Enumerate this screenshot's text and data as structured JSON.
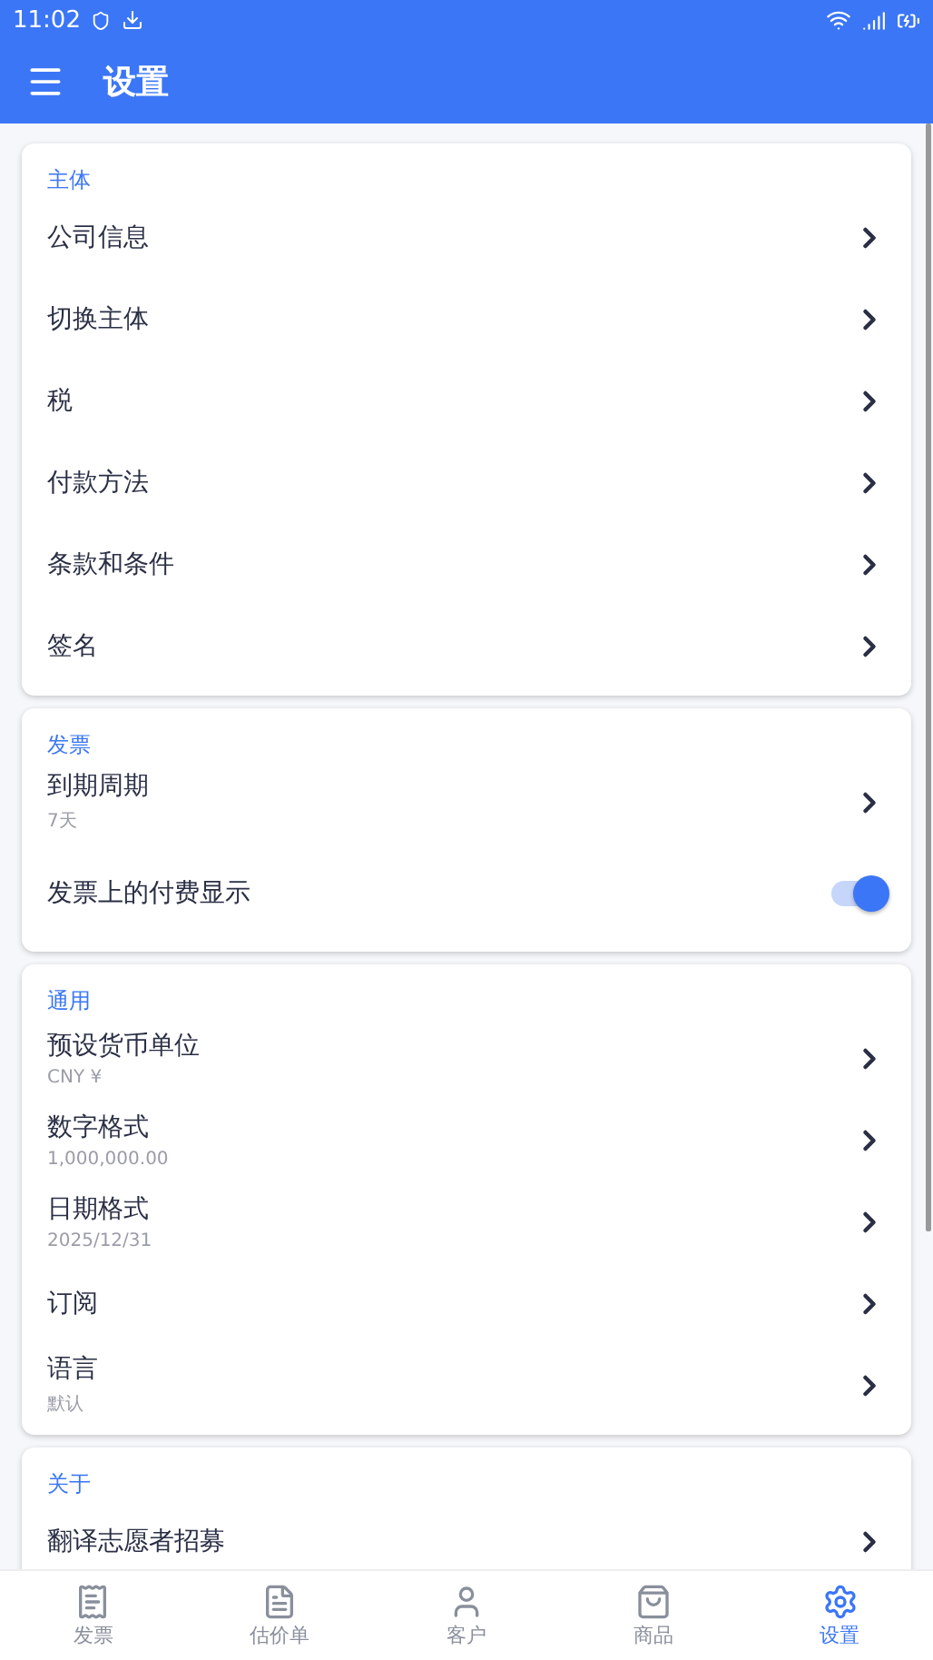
{
  "status_bar": {
    "time": "11:02"
  },
  "app_bar": {
    "title": "设置"
  },
  "sections": [
    {
      "title": "主体",
      "items": [
        {
          "kind": "link",
          "label": "公司信息"
        },
        {
          "kind": "link",
          "label": "切换主体"
        },
        {
          "kind": "link",
          "label": "税"
        },
        {
          "kind": "link",
          "label": "付款方法"
        },
        {
          "kind": "link",
          "label": "条款和条件"
        },
        {
          "kind": "link",
          "label": "签名"
        }
      ]
    },
    {
      "title": "发票",
      "items": [
        {
          "kind": "link",
          "label": "到期周期",
          "subtitle": "7天"
        },
        {
          "kind": "toggle",
          "label": "发票上的付费显示",
          "on": true
        }
      ]
    },
    {
      "title": "通用",
      "items": [
        {
          "kind": "link",
          "label": "预设货币单位",
          "subtitle": "CNY ¥"
        },
        {
          "kind": "link",
          "label": "数字格式",
          "subtitle": "1,000,000.00"
        },
        {
          "kind": "link",
          "label": "日期格式",
          "subtitle": "2025/12/31"
        },
        {
          "kind": "link",
          "label": "订阅"
        },
        {
          "kind": "link",
          "label": "语言",
          "subtitle": "默认"
        }
      ]
    },
    {
      "title": "关于",
      "items": [
        {
          "kind": "link",
          "label": "翻译志愿者招募"
        }
      ]
    }
  ],
  "bottom_nav": [
    {
      "kind": "invoice",
      "label": "发票",
      "selected": false
    },
    {
      "kind": "estimate",
      "label": "估价单",
      "selected": false
    },
    {
      "kind": "client",
      "label": "客户",
      "selected": false
    },
    {
      "kind": "product",
      "label": "商品",
      "selected": false
    },
    {
      "kind": "settings",
      "label": "设置",
      "selected": true
    }
  ]
}
